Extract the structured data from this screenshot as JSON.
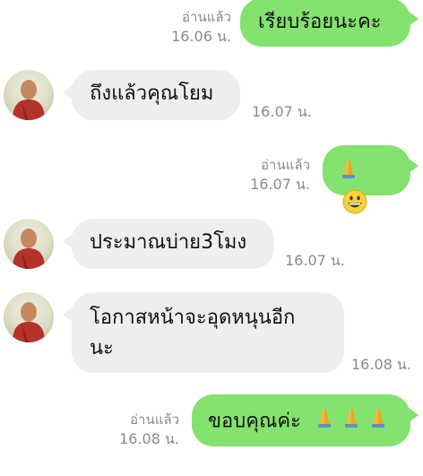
{
  "messages": [
    {
      "text": "เรียบร้อยนะคะ",
      "read": "อ่านแล้ว",
      "time": "16.06 น."
    },
    {
      "text": "ถึงแล้วคุณโยม",
      "time": "16.07 น."
    },
    {
      "text": "",
      "read": "อ่านแล้ว",
      "time": "16.07 น.",
      "emojis": [
        "folded-hands",
        "grinning-face"
      ]
    },
    {
      "text": "ประมาณบ่าย3โมง",
      "time": "16.07 น."
    },
    {
      "text_line1": "โอกาสหน้าจะอุดหนุนอีก",
      "text_line2": "นะ",
      "time": "16.08 น."
    },
    {
      "text": "ขอบคุณค่ะ",
      "read": "อ่านแล้ว",
      "time": "16.08 น.",
      "emojis": [
        "folded-hands",
        "folded-hands",
        "folded-hands"
      ]
    }
  ],
  "colors": {
    "outgoing_bubble": "#84e26f",
    "incoming_bubble": "#eeeeee",
    "meta_text": "#8a8a8a",
    "monk_robe": "#b5322a"
  }
}
